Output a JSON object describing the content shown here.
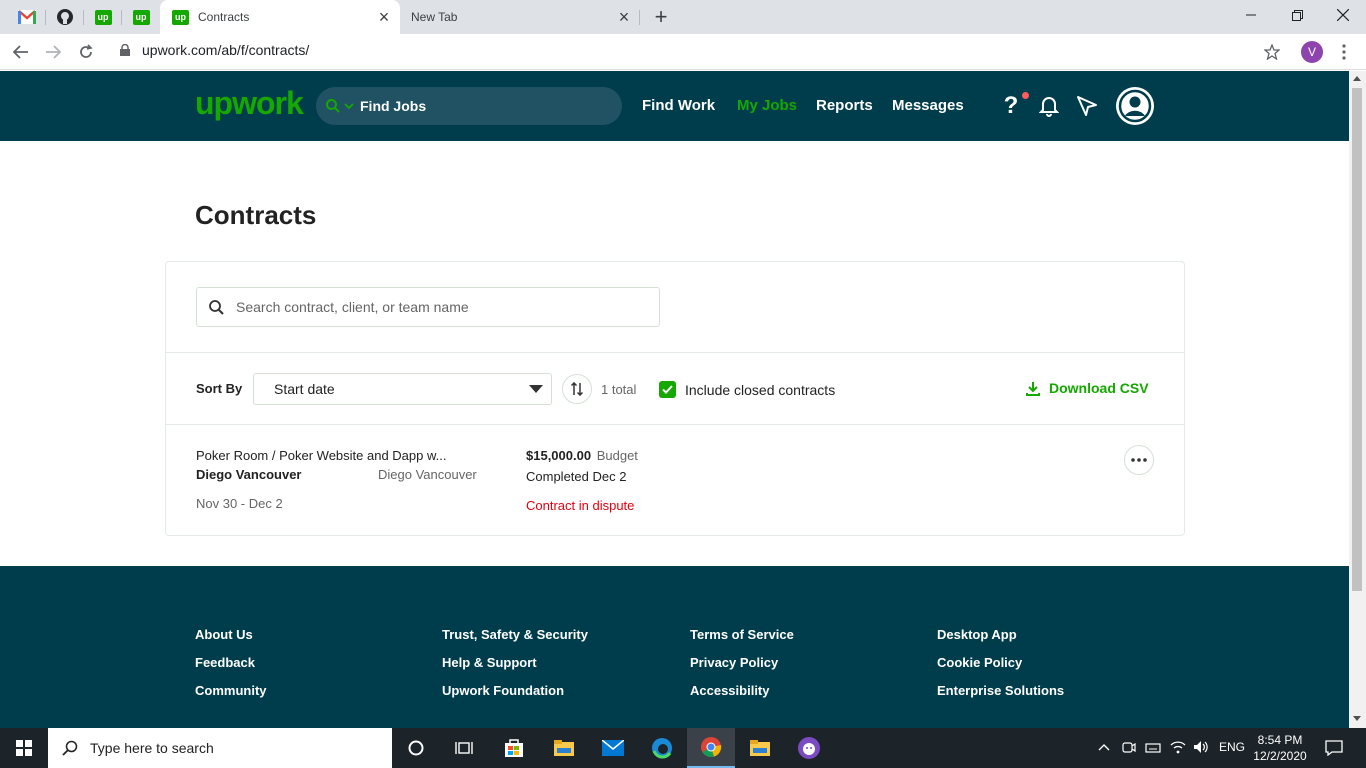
{
  "browser": {
    "active_tab": "Contracts",
    "inactive_tab": "New Tab",
    "url": "upwork.com/ab/f/contracts/",
    "profile_initial": "V",
    "pinned_tabs": [
      "gmail-icon",
      "github-icon",
      "upwork-icon",
      "upwork-icon"
    ]
  },
  "header": {
    "logo": "upwork",
    "search_label": "Find Jobs",
    "nav": [
      "Find Work",
      "My Jobs",
      "Reports",
      "Messages"
    ],
    "active_nav": "My Jobs",
    "help": "?"
  },
  "main": {
    "title": "Contracts",
    "search_placeholder": "Search contract, client, or team name",
    "sort_label": "Sort By",
    "sort_value": "Start date",
    "total": "1 total",
    "include_closed_label": "Include closed contracts",
    "include_closed_checked": true,
    "download_label": "Download CSV",
    "contracts": [
      {
        "title": "Poker Room / Poker Website and Dapp w...",
        "client": "Diego Vancouver",
        "company": "Diego Vancouver",
        "dates": "Nov 30 - Dec 2",
        "amount": "$15,000.00",
        "amount_type": "Budget",
        "status": "Completed Dec 2",
        "alert": "Contract in dispute"
      }
    ]
  },
  "footer": {
    "col1": [
      "About Us",
      "Feedback",
      "Community"
    ],
    "col2": [
      "Trust, Safety & Security",
      "Help & Support",
      "Upwork Foundation"
    ],
    "col3": [
      "Terms of Service",
      "Privacy Policy",
      "Accessibility"
    ],
    "col4": [
      "Desktop App",
      "Cookie Policy",
      "Enterprise Solutions"
    ]
  },
  "taskbar": {
    "search_placeholder": "Type here to search",
    "lang": "ENG",
    "time": "8:54 PM",
    "date": "12/2/2020"
  },
  "colors": {
    "brand_green": "#14a800",
    "header_bg": "#003d4c",
    "dispute_red": "#e3000f"
  }
}
